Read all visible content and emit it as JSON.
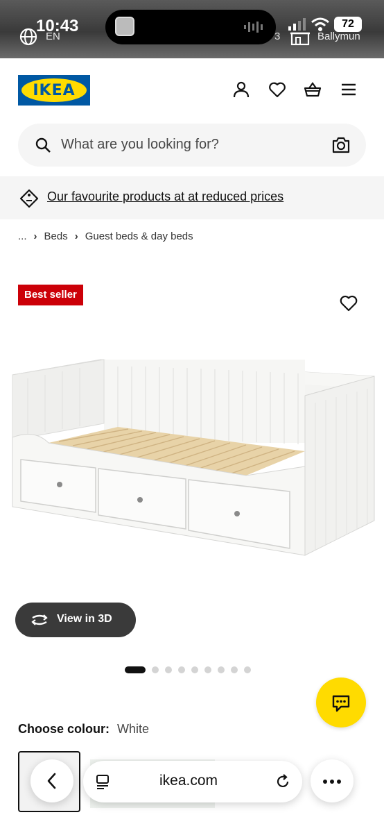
{
  "status_bar": {
    "time": "10:43",
    "language": "EN",
    "partial_text": "3",
    "battery": "72",
    "location": "Ballymun"
  },
  "header": {
    "logo_text": "IKEA",
    "brand_colors": {
      "blue": "#0058a3",
      "yellow": "#ffdb00"
    },
    "icons": [
      "user-icon",
      "heart-icon",
      "basket-icon",
      "menu-icon"
    ]
  },
  "search": {
    "placeholder": "What are you looking for?"
  },
  "promo": {
    "text": "Our favourite products at at reduced prices"
  },
  "breadcrumb": {
    "ellipsis": "...",
    "items": [
      "Beds",
      "Guest beds & day beds"
    ]
  },
  "product": {
    "badge": "Best seller",
    "badge_color": "#cc0008",
    "view_3d_label": "View in 3D",
    "image_count": 9,
    "active_image": 1
  },
  "colour": {
    "label": "Choose colour:",
    "value": "White"
  },
  "browser": {
    "url": "ikea.com"
  }
}
